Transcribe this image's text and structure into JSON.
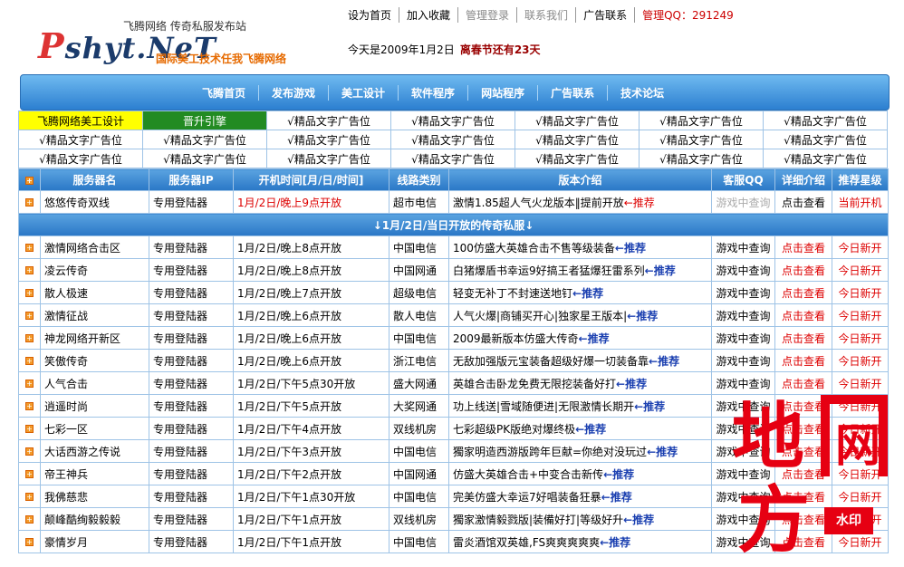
{
  "header": {
    "logo_top": "飞腾网络  传奇私服发布站",
    "logo_p": "P",
    "logo_main": "shyt.NeT",
    "logo_slogan": "国际美工技术任我飞腾网络",
    "toplinks": [
      "设为首页",
      "加入收藏",
      "管理登录",
      "联系我们",
      "广告联系",
      "管理QQ：291249"
    ],
    "date": "今天是2009年1月2日",
    "countdown": "离春节还有23天"
  },
  "nav": [
    "飞腾首页",
    "发布游戏",
    "美工设计",
    "软件程序",
    "网站程序",
    "广告联系",
    "技术论坛"
  ],
  "ads": [
    [
      "飞腾网络美工设计",
      "晋升引擎",
      "√精品文字广告位",
      "√精品文字广告位",
      "√精品文字广告位",
      "√精品文字广告位",
      "√精品文字广告位"
    ],
    [
      "√精品文字广告位",
      "√精品文字广告位",
      "√精品文字广告位",
      "√精品文字广告位",
      "√精品文字广告位",
      "√精品文字广告位",
      "√精品文字广告位"
    ],
    [
      "√精品文字广告位",
      "√精品文字广告位",
      "√精品文字广告位",
      "√精品文字广告位",
      "√精品文字广告位",
      "√精品文字广告位",
      "√精品文字广告位"
    ]
  ],
  "columns": [
    "服务器名",
    "服务器IP",
    "开机时间[月/日/时间]",
    "线路类别",
    "版本介绍",
    "客服QQ",
    "详细介绍",
    "推荐星级"
  ],
  "featured": {
    "name": "悠悠传奇双线",
    "ip": "专用登陆器",
    "time": "1月/2日/晚上9点开放",
    "line": "超市电信",
    "intro": "激情1.85超人气火龙版本‖提前开放",
    "rec": "←推荐",
    "qq": "游戏中查询",
    "detail": "点击查看",
    "star": "当前开机"
  },
  "section_bar": "↓1月/2日/当日开放的传奇私服↓",
  "rows": [
    {
      "name": "激情网络合击区",
      "ip": "专用登陆器",
      "time": "1月/2日/晚上8点开放",
      "line": "中国电信",
      "intro": "100仿盛大英雄合击不售等级装备",
      "rec": "←推荐",
      "qq": "游戏中查询",
      "detail": "点击查看",
      "star": "今日新开"
    },
    {
      "name": "凌云传奇",
      "ip": "专用登陆器",
      "time": "1月/2日/晚上8点开放",
      "line": "中国网通",
      "intro": "白猪爆盾书幸运9好搞王者猛爆狂雷系列",
      "rec": "←推荐",
      "qq": "游戏中查询",
      "detail": "点击查看",
      "star": "今日新开"
    },
    {
      "name": "散人极速",
      "ip": "专用登陆器",
      "time": "1月/2日/晚上7点开放",
      "line": "超级电信",
      "intro": "轻变无补丁不封速送地钉",
      "rec": "←推荐",
      "qq": "游戏中查询",
      "detail": "点击查看",
      "star": "今日新开"
    },
    {
      "name": "激情征战",
      "ip": "专用登陆器",
      "time": "1月/2日/晚上6点开放",
      "line": "散人电信",
      "intro": "人气火爆|商铺买开心|独家星王版本|",
      "rec": "←推荐",
      "qq": "游戏中查询",
      "detail": "点击查看",
      "star": "今日新开"
    },
    {
      "name": "神龙网络开新区",
      "ip": "专用登陆器",
      "time": "1月/2日/晚上6点开放",
      "line": "中国电信",
      "intro": "2009最新版本仿盛大传奇",
      "rec": "←推荐",
      "qq": "游戏中查询",
      "detail": "点击查看",
      "star": "今日新开"
    },
    {
      "name": "笑傲传奇",
      "ip": "专用登陆器",
      "time": "1月/2日/晚上6点开放",
      "line": "浙江电信",
      "intro": "无敌加强版元宝装备超级好爆一切装备靠",
      "rec": "←推荐",
      "qq": "游戏中查询",
      "detail": "点击查看",
      "star": "今日新开"
    },
    {
      "name": "人气合击",
      "ip": "专用登陆器",
      "time": "1月/2日/下午5点30开放",
      "line": "盛大网通",
      "intro": "英雄合击卧龙免费无限挖装备好打",
      "rec": "←推荐",
      "qq": "游戏中查询",
      "detail": "点击查看",
      "star": "今日新开"
    },
    {
      "name": "逍遥时尚",
      "ip": "专用登陆器",
      "time": "1月/2日/下午5点开放",
      "line": "大奖网通",
      "intro": "功上线送|雪域随便进|无限激情长期开",
      "rec": "←推荐",
      "qq": "游戏中查询",
      "detail": "点击查看",
      "star": "今日新开"
    },
    {
      "name": "七彩一区",
      "ip": "专用登陆器",
      "time": "1月/2日/下午4点开放",
      "line": "双线机房",
      "intro": "七彩超级PK版绝对爆终极",
      "rec": "←推荐",
      "qq": "游戏中查询",
      "detail": "点击查看",
      "star": "今日新开"
    },
    {
      "name": "大话西游之传说",
      "ip": "专用登陆器",
      "time": "1月/2日/下午3点开放",
      "line": "中国电信",
      "intro": "獨家明造西游版跨年巨献=你绝对没玩过",
      "rec": "←推荐",
      "qq": "游戏中查询",
      "detail": "点击查看",
      "star": "今日新开"
    },
    {
      "name": "帝王神兵",
      "ip": "专用登陆器",
      "time": "1月/2日/下午2点开放",
      "line": "中国网通",
      "intro": "仿盛大英雄合击+中变合击新传",
      "rec": "←推荐",
      "qq": "游戏中查询",
      "detail": "点击查看",
      "star": "今日新开"
    },
    {
      "name": "我佛慈悲",
      "ip": "专用登陆器",
      "time": "1月/2日/下午1点30开放",
      "line": "中国电信",
      "intro": "完美仿盛大幸运7好唱装备狂暴",
      "rec": "←推荐",
      "qq": "游戏中查询",
      "detail": "点击查看",
      "star": "今日新开"
    },
    {
      "name": "颠峰酷绚毅毅毅",
      "ip": "专用登陆器",
      "time": "1月/2日/下午1点开放",
      "line": "双线机房",
      "intro": "獨家激情毅戮版|装備好打|等级好升",
      "rec": "←推荐",
      "qq": "游戏中查询",
      "detail": "点击查看",
      "star": "今日新开"
    },
    {
      "name": "豪情岁月",
      "ip": "专用登陆器",
      "time": "1月/2日/下午1点开放",
      "line": "中国电信",
      "intro": "雷炎酒馆双英雄,FS爽爽爽爽爽",
      "rec": "←推荐",
      "qq": "游戏中查询",
      "detail": "点击查看",
      "star": "今日新开"
    }
  ],
  "watermark": {
    "line1": "地",
    "line2": "网",
    "line3": "方",
    "badge": "水印"
  },
  "colors": {
    "nav_top": "#6fbaf0",
    "nav_bottom": "#2c7fd0",
    "accent_red": "#d00",
    "rec_blue": "#1a3fb0",
    "watermark": "#e60012"
  }
}
